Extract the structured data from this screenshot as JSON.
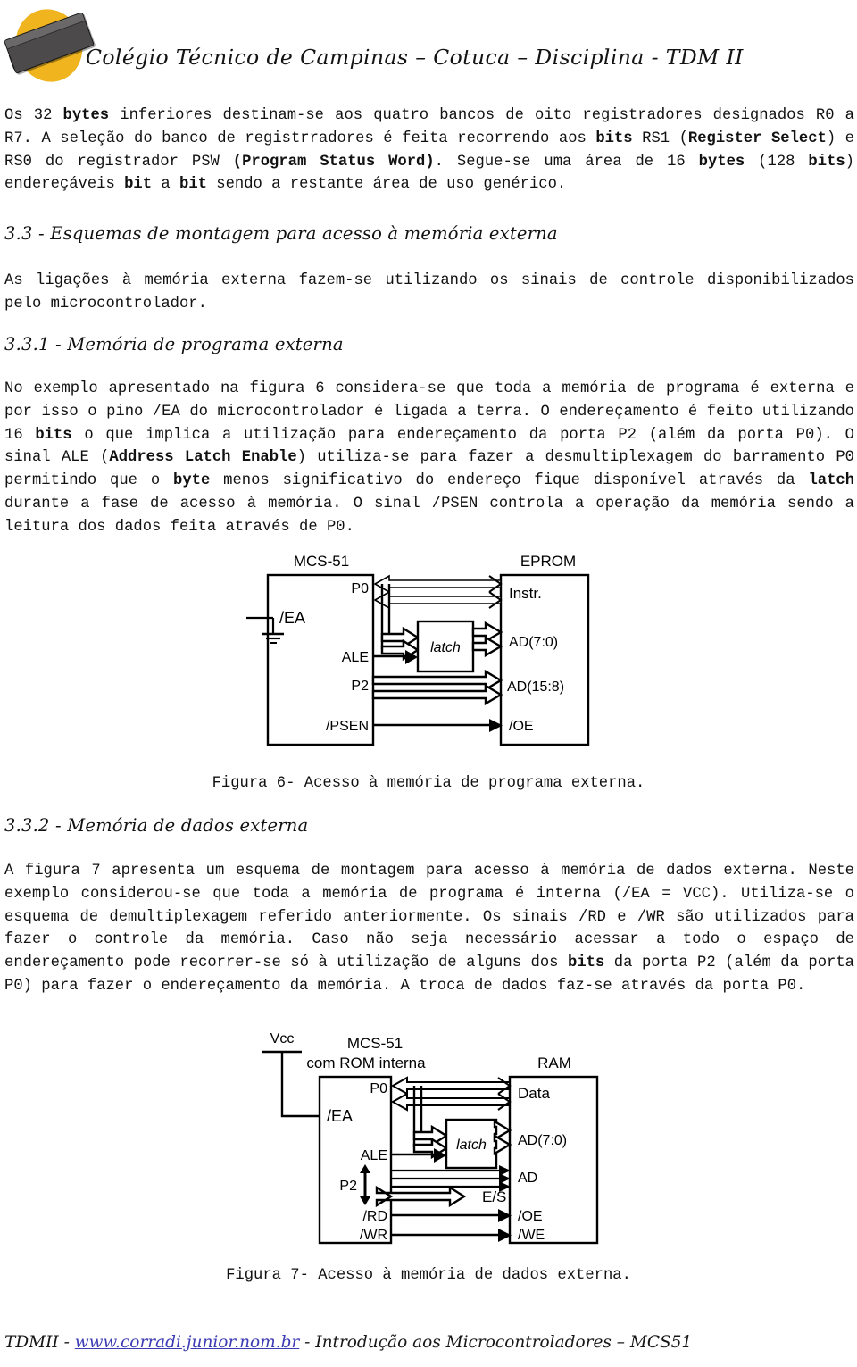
{
  "header": {
    "title": "Colégio Técnico de Campinas – Cotuca – Disciplina - TDM II",
    "logo_icon": "eprom-chip-logo-icon",
    "logo_oval_color": "#f0b41e",
    "logo_chip_color": "#4c4a4a"
  },
  "paragraphs": {
    "p1_a": "Os 32 ",
    "p1_b1": "bytes",
    "p1_c": " inferiores destinam-se aos quatro bancos de oito registradores designados R0 a R7. A seleção do banco de registrradores é feita recorrendo aos ",
    "p1_b2": "bits",
    "p1_d": " RS1 (",
    "p1_b3": "Register Select",
    "p1_e": ") e RS0 do registrador PSW ",
    "p1_b4": "(Program Status Word)",
    "p1_f": ". Segue-se uma área de 16 ",
    "p1_b5": "bytes",
    "p1_g": " (128 ",
    "p1_b6": "bits",
    "p1_h": ") endereçáveis ",
    "p1_b7": "bit",
    "p1_i": " a ",
    "p1_b8": "bit",
    "p1_j": " sendo a restante área de uso genérico.",
    "p2": "As ligações à memória externa fazem-se utilizando os sinais de controle disponibilizados pelo microcontrolador.",
    "p3_a": "No exemplo apresentado na figura 6 considera-se que toda a memória de programa é externa e por isso o pino /EA do microcontrolador é ligada a terra. O endereçamento é feito utilizando 16 ",
    "p3_b1": "bits",
    "p3_c": " o que implica a utilização para endereçamento da porta P2 (além da porta P0). O sinal ALE (",
    "p3_b2": "Address Latch Enable",
    "p3_d": ") utiliza-se para fazer a desmultiplexagem do barramento P0 permitindo que o ",
    "p3_b3": "byte",
    "p3_e": " menos significativo do endereço fique disponível através da ",
    "p3_b4": "latch",
    "p3_f": " durante a fase de acesso à memória. O sinal /PSEN controla a operação da memória sendo a leitura dos dados feita através de P0.",
    "p4_a": "A figura 7 apresenta um esquema de montagem para acesso à memória de dados externa. Neste exemplo considerou-se que toda a memória de programa é interna (/EA = VCC). Utiliza-se o esquema de demultiplexagem referido anteriormente. Os sinais /RD e /WR são utilizados para fazer o controle da memória. Caso não seja necessário acessar a todo o espaço de endereçamento pode recorrer-se só à utilização de alguns dos ",
    "p4_b1": "bits",
    "p4_c": " da porta P2 (além da porta P0) para fazer o endereçamento da memória. A troca de dados faz-se através da porta P0."
  },
  "headings": {
    "h33": "3.3 - Esquemas de montagem para acesso à memória externa",
    "h331": "3.3.1 - Memória de programa externa",
    "h332": "3.3.2 - Memória de dados externa"
  },
  "captions": {
    "fig6": "Figura 6- Acesso à memória de programa externa.",
    "fig7": "Figura 7- Acesso à memória de dados externa."
  },
  "figure6": {
    "left_block_label": "MCS-51",
    "right_block_label": "EPROM",
    "left_pins": [
      "/EA",
      "ALE",
      "P2",
      "/PSEN"
    ],
    "left_top_pin": "P0",
    "right_pins": [
      "Instr.",
      "AD(7:0)",
      "AD(15:8)",
      "/OE"
    ],
    "latch_label": "latch",
    "ground_symbol": "ground-icon"
  },
  "figure7": {
    "supply_label": "Vcc",
    "left_block_label_line1": "MCS-51",
    "left_block_label_line2": "com ROM interna",
    "right_block_label": "RAM",
    "left_top_pin": "P0",
    "left_pins": [
      "/EA",
      "ALE",
      "P2",
      "/RD",
      "/WR"
    ],
    "right_pins": [
      "Data",
      "AD(7:0)",
      "AD",
      "/OE",
      "/WE"
    ],
    "latch_label": "latch",
    "io_label": "E/S"
  },
  "footer": {
    "prefix": "TDMII - ",
    "link": "www.corradi.junior.nom.br",
    "suffix": " - Introdução aos Microcontroladores – MCS51",
    "link_color": "#3c3cb4"
  }
}
